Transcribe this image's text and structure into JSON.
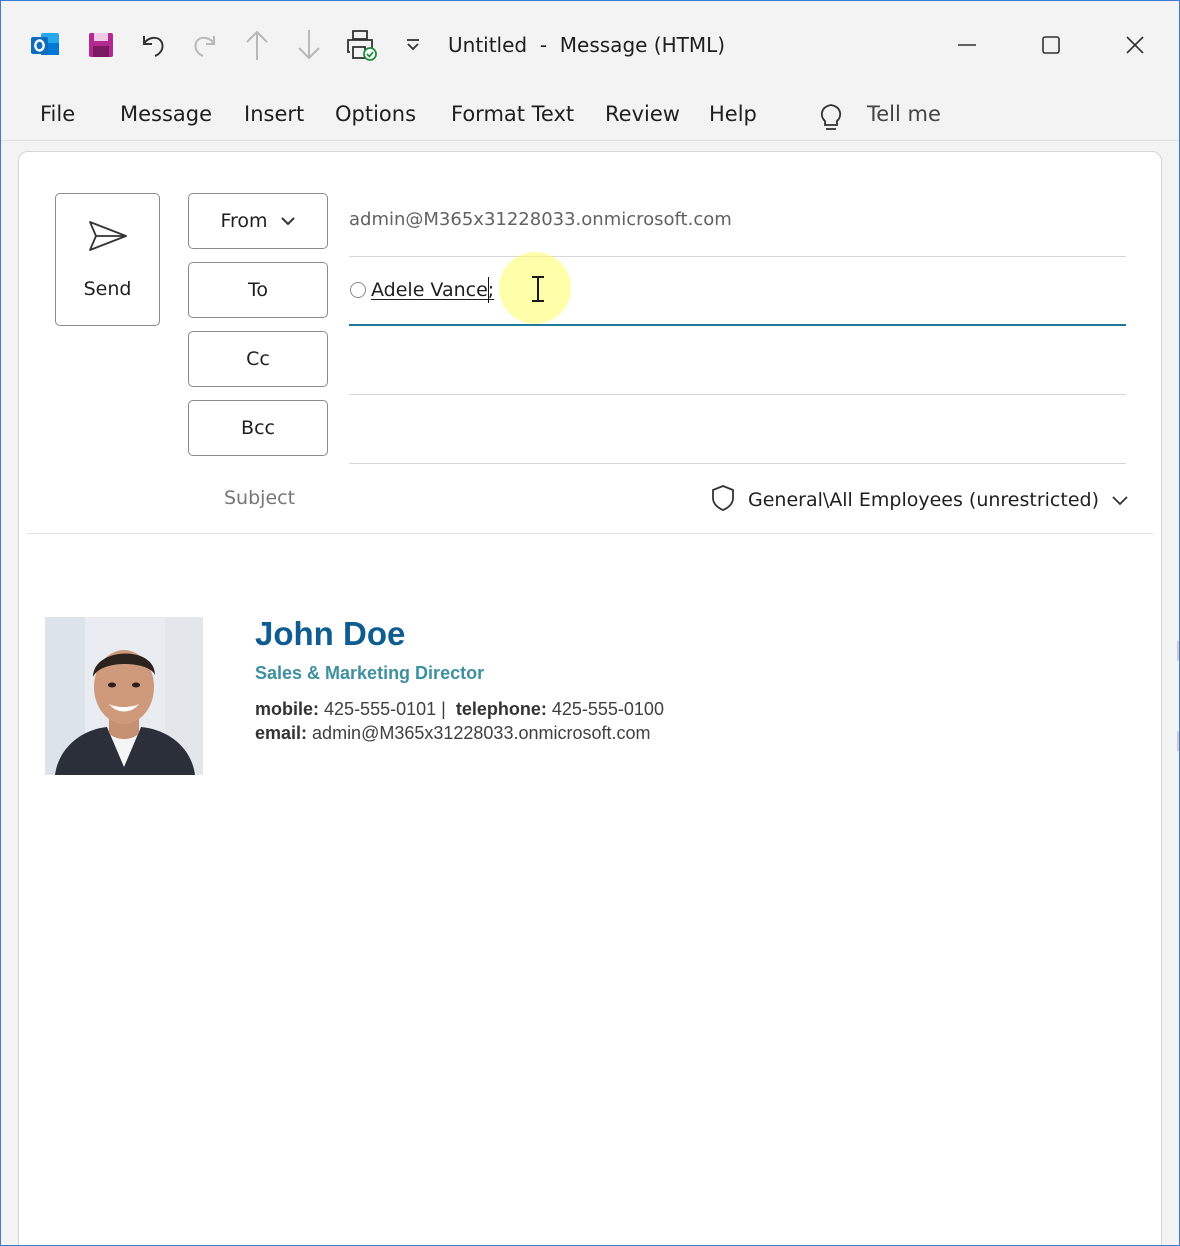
{
  "window": {
    "title": "Untitled",
    "separator": "-",
    "subtitle": "Message (HTML)"
  },
  "titlebar_icons": [
    "outlook-logo",
    "save-icon",
    "undo-icon",
    "redo-icon",
    "previous-item-icon",
    "next-item-icon",
    "print-icon",
    "customize-toolbar-icon"
  ],
  "menu": {
    "items": [
      "File",
      "Message",
      "Insert",
      "Options",
      "Format Text",
      "Review",
      "Help"
    ],
    "tell_me": "Tell me"
  },
  "compose": {
    "send_label": "Send",
    "from_label": "From",
    "from_value": "admin@M365x31228033.onmicrosoft.com",
    "to_label": "To",
    "to_recipient": "Adele Vance;",
    "cc_label": "Cc",
    "bcc_label": "Bcc",
    "subject_label": "Subject",
    "sensitivity_label": "General\\All Employees (unrestricted)"
  },
  "signature": {
    "name": "John Doe",
    "title": "Sales & Marketing Director",
    "mobile_label": "mobile:",
    "mobile_value": "425-555-0101",
    "telephone_label": "telephone:",
    "telephone_value": "425-555-0100",
    "email_label": "email:",
    "email_value": "admin@M365x31228033.onmicrosoft.com"
  },
  "colors": {
    "accent_line": "#1e7a9a",
    "signature_name": "#0f5c91",
    "signature_title": "#3e8fa0",
    "save_icon": "#b4298f",
    "outlook_blue": "#0f6cbd"
  }
}
